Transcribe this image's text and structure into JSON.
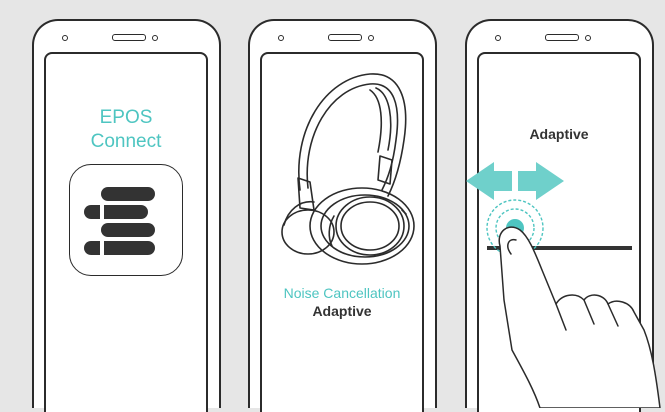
{
  "panel1": {
    "app_name_line1": "EPOS",
    "app_name_line2": "Connect"
  },
  "panel2": {
    "feature_label": "Noise Cancellation",
    "mode_value": "Adaptive"
  },
  "panel3": {
    "mode_value": "Adaptive"
  },
  "colors": {
    "accent": "#4ec5c1",
    "outline": "#2b2b2b",
    "background": "#e6e6e6",
    "logo": "#333333"
  },
  "icons": [
    "epos-logo-icon",
    "headphones-icon",
    "swipe-arrows-icon",
    "touch-ripple-icon",
    "finger-icon"
  ]
}
